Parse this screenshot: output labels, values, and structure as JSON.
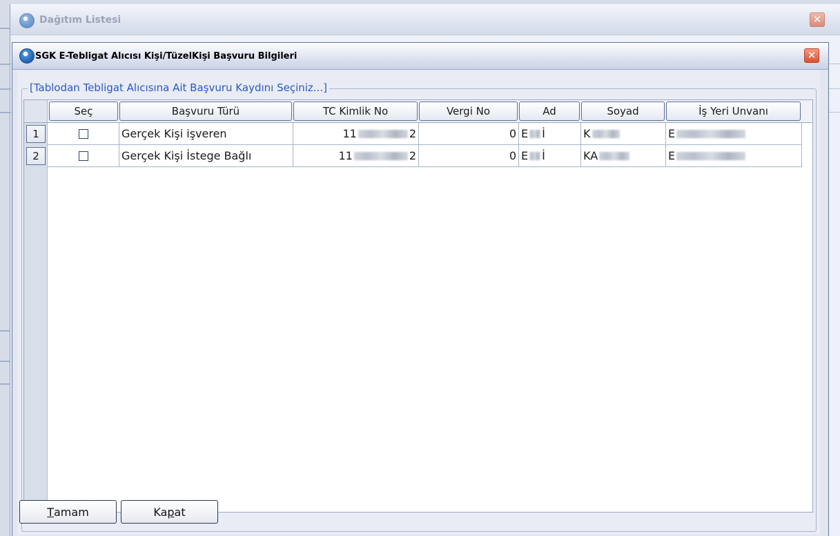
{
  "outer_window": {
    "title": "Dağıtım Listesi",
    "close_symbol": "✕"
  },
  "dialog": {
    "title": "SGK E-Tebligat Alıcısı Kişi/TüzelKişi Başvuru Bilgileri",
    "close_symbol": "✕",
    "group_legend": "[Tablodan Tebligat Alıcısına Ait Başvuru Kaydını Seçiniz...]"
  },
  "table": {
    "columns": [
      "Seç",
      "Başvuru Türü",
      "TC Kimlik No",
      "Vergi No",
      "Ad",
      "Soyad",
      "İş Yeri Unvanı"
    ],
    "rows": [
      {
        "num": "1",
        "checked": false,
        "basvuru_turu": "Gerçek Kişi işveren",
        "tc_prefix": "11",
        "tc_suffix": "2",
        "vergi_no": "0",
        "ad_prefix": "E",
        "ad_suffix": "İ",
        "soyad_prefix": "K",
        "isyeri_prefix": "E"
      },
      {
        "num": "2",
        "checked": false,
        "basvuru_turu": "Gerçek Kişi İstege Bağlı",
        "tc_prefix": "11",
        "tc_suffix": "2",
        "vergi_no": "0",
        "ad_prefix": "E",
        "ad_suffix": "İ",
        "soyad_prefix": "KA",
        "isyeri_prefix": "E"
      }
    ]
  },
  "buttons": {
    "ok_accel": "T",
    "ok_rest": "amam",
    "close_pre": "Ka",
    "close_accel": "p",
    "close_post": "at"
  },
  "icons": {
    "app": "app-logo-icon",
    "close": "close-icon",
    "checkbox": "checkbox-icon"
  }
}
